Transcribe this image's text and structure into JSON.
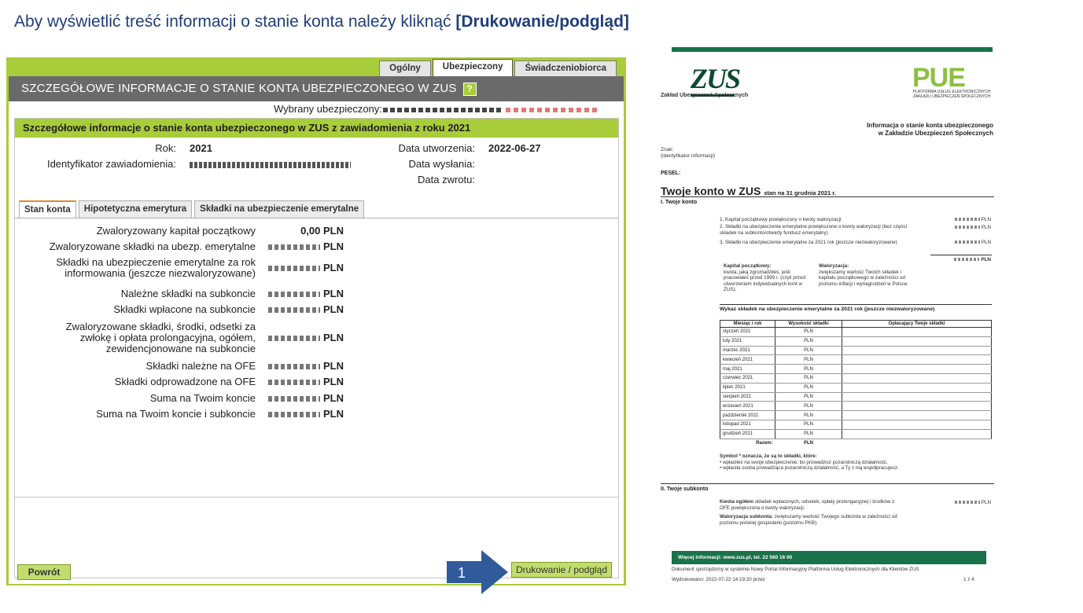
{
  "slide": {
    "title_plain": "Aby wyświetlić treść informacji o stanie konta należy kliknąć ",
    "title_bold": "[Drukowanie/podgląd]"
  },
  "app": {
    "tabs": [
      "Ogólny",
      "Ubezpieczony",
      "Świadczeniobiorca"
    ],
    "active_tab": "Ubezpieczony",
    "header_title": "SZCZEGÓŁOWE INFORMACJE O STANIE KONTA UBEZPIECZONEGO W ZUS",
    "help_symbol": "?",
    "selected_label": "Wybrany ubezpieczony:",
    "section_title": "Szczegółowe informacje o stanie konta ubezpieczonego w ZUS z zawiadomienia z roku 2021",
    "info": {
      "rok_label": "Rok:",
      "rok_value": "2021",
      "id_label": "Identyfikator zawiadomienia:",
      "created_label": "Data utworzenia:",
      "created_value": "2022-06-27",
      "sent_label": "Data wysłania:",
      "returned_label": "Data zwrotu:"
    },
    "subtabs": [
      "Stan konta",
      "Hipotetyczna emerytura",
      "Składki na ubezpieczenie emerytalne"
    ],
    "rows": [
      {
        "label": "Zwaloryzowany kapitał początkowy",
        "value": "0,00 PLN"
      },
      {
        "label": "Zwaloryzowane składki na ubezp. emerytalne",
        "value": "PLN"
      },
      {
        "label": "Składki na ubezpieczenie emerytalne za rok informowania (jeszcze niezwaloryzowane)",
        "value": "PLN"
      },
      {
        "label": "Należne składki na subkoncie",
        "value": "PLN"
      },
      {
        "label": "Składki wpłacone na subkoncie",
        "value": "PLN"
      },
      {
        "label": "Zwaloryzowane składki, środki, odsetki za zwłokę i opłata prolongacyjna, ogółem, zewidencjonowane na subkoncie",
        "value": "PLN"
      },
      {
        "label": "Składki należne na OFE",
        "value": "PLN"
      },
      {
        "label": "Składki odprowadzone na OFE",
        "value": "PLN"
      },
      {
        "label": "Suma na Twoim koncie",
        "value": "PLN"
      },
      {
        "label": "Suma na Twoim koncie i subkoncie",
        "value": "PLN"
      }
    ],
    "btn_back": "Powrót",
    "btn_print": "Drukowanie / podgląd",
    "arrow_number": "1"
  },
  "doc": {
    "zus_logo": "ZUS",
    "zus_name": "Zakład Ubezpieczeń Społecznych",
    "pue_logo": "PUE",
    "pue_text": "PLATFORMA USŁUG ELEKTRONICZNYCH ZAKŁADU UBEZPIECZEŃ SPOŁECZNYCH",
    "header_line1": "Informacja o stanie konta ubezpieczonego",
    "header_line2": "w Zakładzie Ubezpieczeń Społecznych",
    "znak": "Znak:",
    "znak_sub": "(identyfikator informacji)",
    "pesel": "PESEL:",
    "h1": "Twoje konto w ZUS",
    "h1_small": "stan na 31 grudnia 2021 r.",
    "sec1": "I. Twoje konto",
    "items": [
      "1. Kapitał początkowy powiększony o kwoty waloryzacji",
      "2. Składki na ubezpieczenie emerytalne powiększone o kwoty waloryzacji (bez części składek na subkonto/otwarty fundusz emerytalny)",
      "3. Składki na ubezpieczenie emerytalne za 2021 rok (jeszcze niezwaloryzowane)"
    ],
    "pln": "PLN",
    "kapital_title": "Kapitał początkowy:",
    "kapital_text": "kwota, jaką zgromadziłeś, jeśli pracowałeś przed 1999 r. (czyli przed utworzeniem indywidualnych kont w ZUS).",
    "waloryzacja_title": "Waloryzacja:",
    "waloryzacja_text": "zwiększamy wartość Twoich składek i kapitału początkowego w zależności od poziomu inflacji i wynagrodzeń w Polsce.",
    "wykaz_title": "Wykaz składek na ubezpieczenie emerytalne za 2021 rok (jeszcze niezwaloryzowane)",
    "table_headers": [
      "Miesiąc i rok",
      "Wysokość składki",
      "Opłacający Twoje składki"
    ],
    "months": [
      "styczeń 2021",
      "luty 2021",
      "marzec 2021",
      "kwiecień 2021",
      "maj 2021",
      "czerwiec 2021",
      "lipiec 2021",
      "sierpień 2021",
      "wrzesień 2021",
      "październik 2021",
      "listopad 2021",
      "grudzień 2021"
    ],
    "razem": "Razem:",
    "symbol_line": "Symbol * oznacza, że są to składki, które:",
    "symbol_b1": "• wpłaciłeś na swoje ubezpieczenie, bo prowadzisz pozarolniczą działalność,",
    "symbol_b2": "• wpłaciła osoba prowadząca pozarolniczą działalność, a Ty z nią współpracujesz.",
    "sec2": "II. Twoje subkonto",
    "kwota_title": "Kwota ogółem",
    "kwota_text": "składek wpłaconych, odsetek, opłaty prolongacyjnej i środków z OFE powiększona o kwoty waloryzacji.",
    "walsub_title": "Waloryzacja subkonta:",
    "walsub_text": "zwiększamy wartość Twojego subkonta w zależności od poziomu polskiej gospodarki (poziomu PKB).",
    "footer_bar": "Więcej informacji: www.zus.pl, tel. 22 560 16 00",
    "footer_line1": "Dokument sporządzony w systemie Nowy Portal Informacyjny Platforma Usług Elektronicznych dla Klientów ZUS",
    "footer_line2": "Wydrukowano: 2022-07-22 14:19:20 przez",
    "page": "1 z 4"
  },
  "colors": {
    "accent_green": "#a9cc3a",
    "header_gray": "#6a6a6a",
    "arrow_blue": "#2f5b9a",
    "zus_green": "#19724a"
  }
}
